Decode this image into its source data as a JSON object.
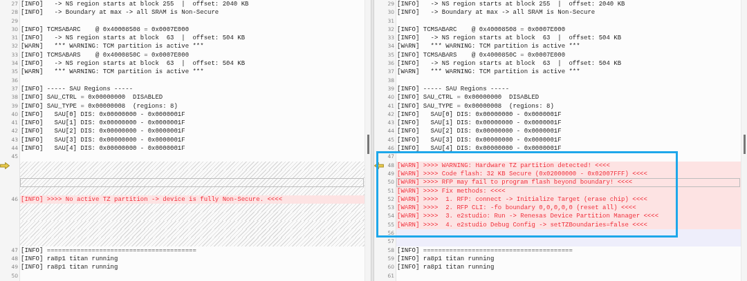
{
  "panes": [
    {
      "rows": [
        {
          "kind": "line",
          "number": "27",
          "text": "[INFO]   -> NS region starts at block 255  |  offset: 2040 KB"
        },
        {
          "kind": "line",
          "number": "28",
          "text": "[INFO]   -> Boundary at max -> all SRAM is Non-Secure"
        },
        {
          "kind": "line",
          "number": "29",
          "text": ""
        },
        {
          "kind": "line",
          "number": "30",
          "text": "[INFO] TCMSABARC    @ 0x40008508 = 0x0007E000"
        },
        {
          "kind": "line",
          "number": "31",
          "text": "[INFO]   -> NS region starts at block  63  |  offset: 504 KB"
        },
        {
          "kind": "line",
          "number": "32",
          "text": "[WARN]   *** WARNING: TCM partition is active ***"
        },
        {
          "kind": "line",
          "number": "33",
          "text": "[INFO] TCMSABARS    @ 0x4000850C = 0x0007E000"
        },
        {
          "kind": "line",
          "number": "34",
          "text": "[INFO]   -> NS region starts at block  63  |  offset: 504 KB"
        },
        {
          "kind": "line",
          "number": "35",
          "text": "[WARN]   *** WARNING: TCM partition is active ***"
        },
        {
          "kind": "line",
          "number": "36",
          "text": ""
        },
        {
          "kind": "line",
          "number": "37",
          "text": "[INFO] ----- SAU Regions -----"
        },
        {
          "kind": "line",
          "number": "38",
          "text": "[INFO] SAU_CTRL = 0x00000000  DISABLED"
        },
        {
          "kind": "line",
          "number": "39",
          "text": "[INFO] SAU_TYPE = 0x00000008  (regions: 8)"
        },
        {
          "kind": "line",
          "number": "40",
          "text": "[INFO]   SAU[0] DIS: 0x00000000 - 0x0000001F"
        },
        {
          "kind": "line",
          "number": "41",
          "text": "[INFO]   SAU[1] DIS: 0x00000000 - 0x0000001F"
        },
        {
          "kind": "line",
          "number": "42",
          "text": "[INFO]   SAU[2] DIS: 0x00000000 - 0x0000001F"
        },
        {
          "kind": "line",
          "number": "43",
          "text": "[INFO]   SAU[3] DIS: 0x00000000 - 0x0000001F"
        },
        {
          "kind": "line",
          "number": "44",
          "text": "[INFO]   SAU[4] DIS: 0x00000000 - 0x0000001F"
        },
        {
          "kind": "line",
          "number": "45",
          "text": ""
        },
        {
          "kind": "filler",
          "marker": true
        },
        {
          "kind": "filler"
        },
        {
          "kind": "filler",
          "current": true
        },
        {
          "kind": "filler"
        },
        {
          "kind": "changed",
          "number": "46",
          "text": "[INFO] >>>> No active TZ partition -> device is fully Non-Secure. <<<<"
        },
        {
          "kind": "filler"
        },
        {
          "kind": "filler"
        },
        {
          "kind": "filler"
        },
        {
          "kind": "filler"
        },
        {
          "kind": "filler"
        },
        {
          "kind": "line",
          "number": "47",
          "text": "[INFO] ========================================"
        },
        {
          "kind": "line",
          "number": "48",
          "text": "[INFO] ra8p1 titan running"
        },
        {
          "kind": "line",
          "number": "49",
          "text": "[INFO] ra8p1 titan running"
        },
        {
          "kind": "line",
          "number": "50",
          "text": ""
        }
      ]
    },
    {
      "rows": [
        {
          "kind": "line",
          "number": "29",
          "text": "[INFO]   -> NS region starts at block 255  |  offset: 2040 KB"
        },
        {
          "kind": "line",
          "number": "30",
          "text": "[INFO]   -> Boundary at max -> all SRAM is Non-Secure"
        },
        {
          "kind": "line",
          "number": "31",
          "text": ""
        },
        {
          "kind": "line",
          "number": "32",
          "text": "[INFO] TCMSABARC    @ 0x40008508 = 0x0007E000"
        },
        {
          "kind": "line",
          "number": "33",
          "text": "[INFO]   -> NS region starts at block  63  |  offset: 504 KB"
        },
        {
          "kind": "line",
          "number": "34",
          "text": "[WARN]   *** WARNING: TCM partition is active ***"
        },
        {
          "kind": "line",
          "number": "35",
          "text": "[INFO] TCMSABARS    @ 0x4000850C = 0x0007E000"
        },
        {
          "kind": "line",
          "number": "36",
          "text": "[INFO]   -> NS region starts at block  63  |  offset: 504 KB"
        },
        {
          "kind": "line",
          "number": "37",
          "text": "[WARN]   *** WARNING: TCM partition is active ***"
        },
        {
          "kind": "line",
          "number": "38",
          "text": ""
        },
        {
          "kind": "line",
          "number": "39",
          "text": "[INFO] ----- SAU Regions -----"
        },
        {
          "kind": "line",
          "number": "40",
          "text": "[INFO] SAU_CTRL = 0x00000000  DISABLED"
        },
        {
          "kind": "line",
          "number": "41",
          "text": "[INFO] SAU_TYPE = 0x00000008  (regions: 8)"
        },
        {
          "kind": "line",
          "number": "42",
          "text": "[INFO]   SAU[0] DIS: 0x00000000 - 0x0000001F"
        },
        {
          "kind": "line",
          "number": "43",
          "text": "[INFO]   SAU[1] DIS: 0x00000000 - 0x0000001F"
        },
        {
          "kind": "line",
          "number": "44",
          "text": "[INFO]   SAU[2] DIS: 0x00000000 - 0x0000001F"
        },
        {
          "kind": "line",
          "number": "45",
          "text": "[INFO]   SAU[3] DIS: 0x00000000 - 0x0000001F"
        },
        {
          "kind": "line",
          "number": "46",
          "text": "[INFO]   SAU[4] DIS: 0x00000000 - 0x0000001F"
        },
        {
          "kind": "highlight",
          "rows": [
            {
              "kind": "line",
              "number": "47",
              "text": ""
            },
            {
              "kind": "changed",
              "number": "48",
              "text": "[WARN] >>>> WARNING: Hardware TZ partition detected! <<<<",
              "marker": true
            },
            {
              "kind": "changed",
              "number": "49",
              "text": "[WARN] >>>> Code flash: 32 KB Secure (0x02000000 - 0x02007FFF) <<<<"
            },
            {
              "kind": "changed",
              "number": "50",
              "text": "[WARN] >>>> RFP may fail to program flash beyond boundary! <<<<",
              "current": true
            },
            {
              "kind": "changed",
              "number": "51",
              "text": "[WARN] >>>> Fix methods: <<<<"
            },
            {
              "kind": "changed",
              "number": "52",
              "text": "[WARN] >>>>  1. RFP: connect -> Initialize Target (erase chip) <<<<"
            },
            {
              "kind": "changed",
              "number": "53",
              "text": "[WARN] >>>>  2. RFP CLI: -fo boundary 0,0,0,0,0 (reset all) <<<<"
            },
            {
              "kind": "changed",
              "number": "54",
              "text": "[WARN] >>>>  3. e2studio: Run -> Renesas Device Partition Manager <<<<"
            },
            {
              "kind": "changed",
              "number": "55",
              "text": "[WARN] >>>>  4. e2studio Debug Config -> setTZBoundaries=false <<<<"
            },
            {
              "kind": "modified",
              "number": "56",
              "text": ""
            }
          ]
        },
        {
          "kind": "modified",
          "number": "57",
          "text": ""
        },
        {
          "kind": "line",
          "number": "58",
          "text": "[INFO] ========================================"
        },
        {
          "kind": "line",
          "number": "59",
          "text": "[INFO] ra8p1 titan running"
        },
        {
          "kind": "line",
          "number": "60",
          "text": "[INFO] ra8p1 titan running"
        },
        {
          "kind": "line",
          "number": "61",
          "text": ""
        }
      ]
    }
  ]
}
